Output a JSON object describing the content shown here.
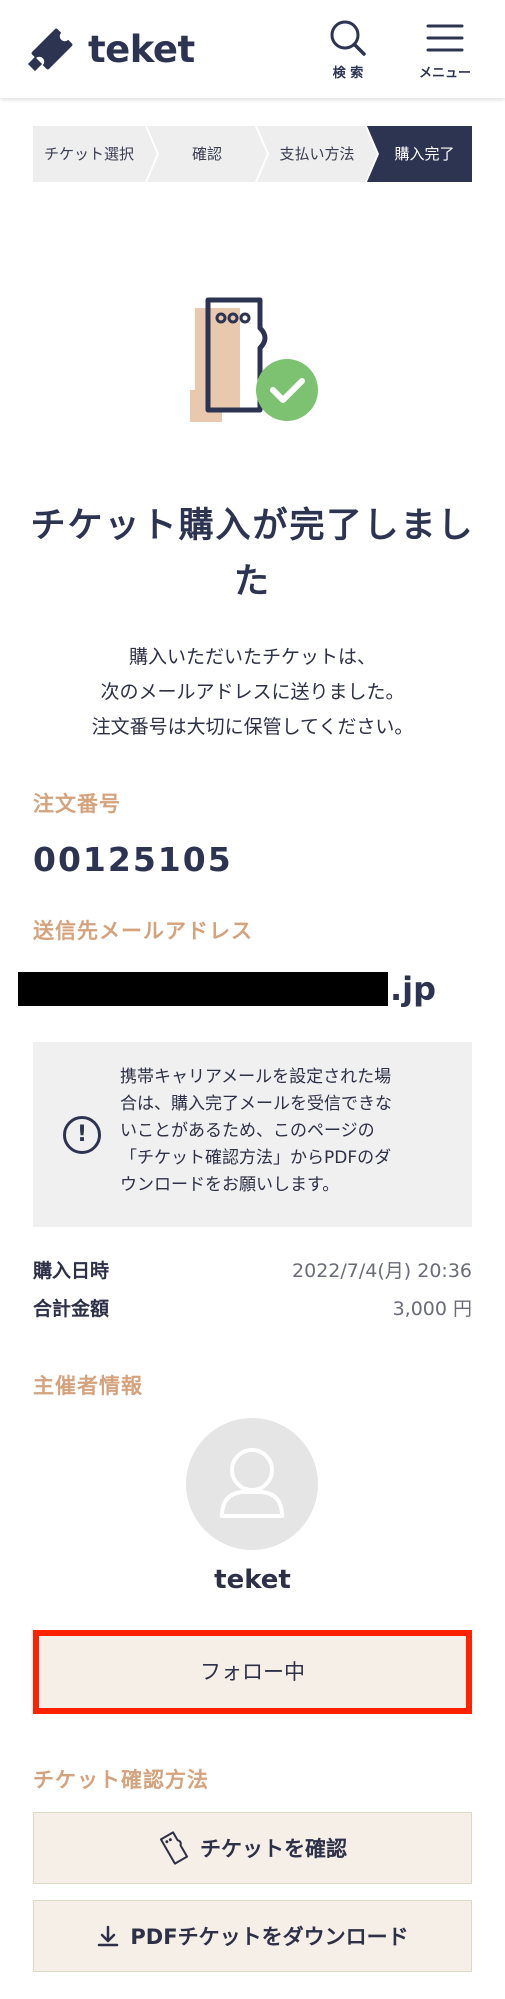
{
  "header": {
    "logo_text": "teket",
    "search_label": "検 索",
    "menu_label": "メニュー"
  },
  "breadcrumb": {
    "steps": [
      "チケット選択",
      "確認",
      "支払い方法",
      "購入完了"
    ],
    "active_index": 3,
    "active_color": "#2d3452",
    "inactive_color": "#eeeeee"
  },
  "completion": {
    "title": "チケット購入が完了しました",
    "desc_lines": [
      "購入いただいたチケットは、",
      "次のメールアドレスに送りました。",
      "注文番号は大切に保管してください。"
    ]
  },
  "order": {
    "number_label": "注文番号",
    "number": "00125105",
    "email_label": "送信先メールアドレス",
    "email_suffix": ".jp"
  },
  "notice": {
    "lines": [
      "携帯キャリアメールを設定された場",
      "合は、購入完了メールを受信できな",
      "いことがあるため、このページの",
      "「チケット確認方法」からPDFのダ",
      "ウンロードをお願いします。"
    ]
  },
  "purchase_info": {
    "date_label": "購入日時",
    "date_value": "2022/7/4(月) 20:36",
    "total_label": "合計金額",
    "total_value": "3,000 円"
  },
  "organizer": {
    "section_label": "主催者情報",
    "name": "teket",
    "follow_label": "フォロー中"
  },
  "ticket_methods": {
    "section_label": "チケット確認方法",
    "view_ticket_label": "チケットを確認",
    "download_pdf_label": "PDFチケットをダウンロード"
  },
  "colors": {
    "accent": "#d4a37e",
    "navy": "#2d3452",
    "success": "#7cc270",
    "highlight_border": "#ff2200"
  }
}
